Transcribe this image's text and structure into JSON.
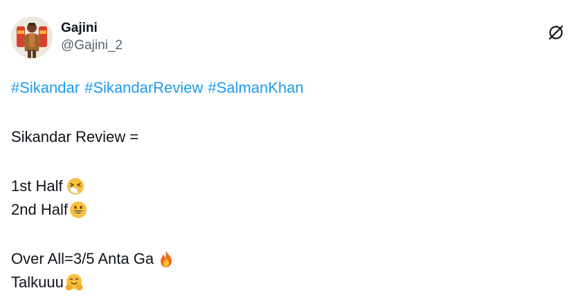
{
  "author": {
    "display_name": "Gajini",
    "handle": "@Gajini_2",
    "avatar_icon": "avatar-image"
  },
  "actions": {
    "grok_icon": "grok-slashed-circle-icon"
  },
  "tweet": {
    "hashtags": [
      "#Sikandar",
      "#SikandarReview",
      "#SalmanKhan"
    ],
    "line_review": "Sikandar Review =",
    "line_first_half": "1st Half",
    "first_half_emoji": "sneezing-face-emoji",
    "line_second_half": "2nd Half",
    "second_half_emoji": "grinning-face-emoji",
    "line_overall": "Over All=3/5 Anta Ga",
    "overall_emoji": "fire-emoji",
    "line_talkuuu": "Talkuuu",
    "talkuuu_emoji": "hugging-face-emoji"
  },
  "colors": {
    "hashtag": "#1d9bf0",
    "text": "#0f1419",
    "secondary_text": "#536471"
  }
}
